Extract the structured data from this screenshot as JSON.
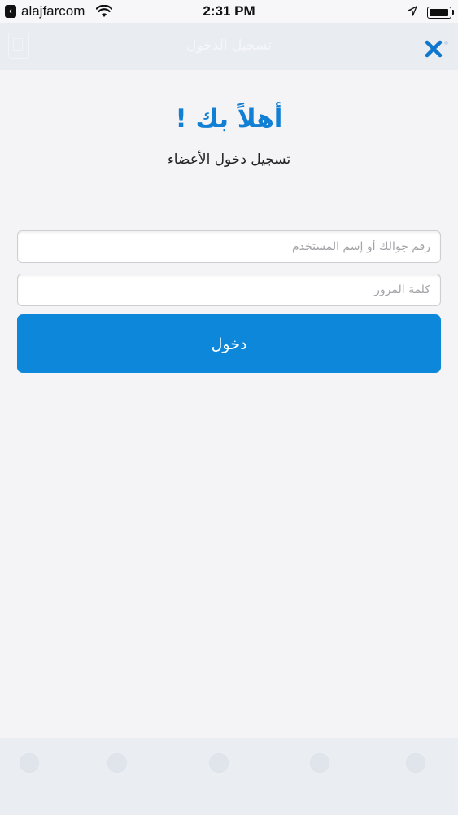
{
  "status_bar": {
    "back_label": "alajfarcom",
    "time": "2:31 PM"
  },
  "nav": {
    "title": "تسجيل الدخول"
  },
  "login": {
    "welcome": "أهلاً بك !",
    "subtitle": "تسجيل دخول الأعضاء",
    "username_placeholder": "رقم جوالك أو إسم المستخدم",
    "password_placeholder": "كلمة المرور",
    "submit_label": "دخول"
  },
  "colors": {
    "accent": "#1180d4",
    "button": "#0c87da",
    "background": "#f4f3f6"
  },
  "tab_bar": {
    "items": [
      {
        "icon": "home-icon"
      },
      {
        "icon": "chat-icon"
      },
      {
        "icon": "bell-icon"
      },
      {
        "icon": "list-icon"
      },
      {
        "icon": "user-icon"
      }
    ]
  }
}
